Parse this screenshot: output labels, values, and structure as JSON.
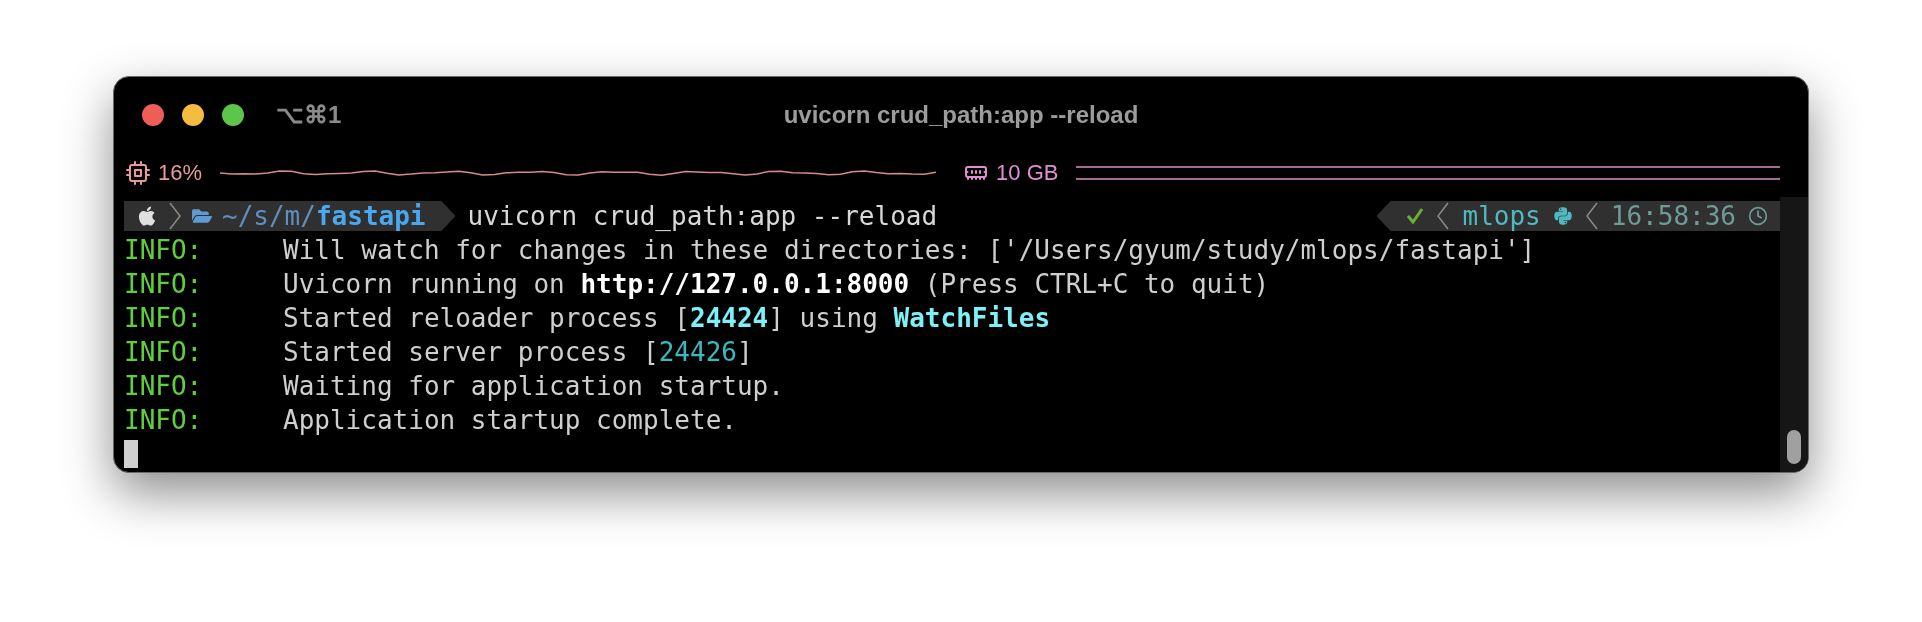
{
  "window": {
    "title": "uvicorn crud_path:app --reload",
    "shortcut": "⌥⌘1"
  },
  "status_bar": {
    "cpu": "16%",
    "memory": "10 GB"
  },
  "prompt": {
    "path_prefix": "~/s/m/",
    "path_current": "fastapi",
    "command": "uvicorn crud_path:app --reload",
    "status_ok": true,
    "env": "mlops",
    "time": "16:58:36"
  },
  "log_lines": [
    {
      "level": "INFO:",
      "parts": [
        {
          "kind": "plain",
          "text": "Will watch for changes in these directories: ['/Users/gyum/study/mlops/fastapi']"
        }
      ]
    },
    {
      "level": "INFO:",
      "parts": [
        {
          "kind": "plain",
          "text": "Uvicorn running on "
        },
        {
          "kind": "bold",
          "text": "http://127.0.0.1:8000"
        },
        {
          "kind": "plain",
          "text": " (Press CTRL+C to quit)"
        }
      ]
    },
    {
      "level": "INFO:",
      "parts": [
        {
          "kind": "plain",
          "text": "Started reloader process ["
        },
        {
          "kind": "cyan-bold",
          "text": "24424"
        },
        {
          "kind": "plain",
          "text": "] using "
        },
        {
          "kind": "cyan-bold",
          "text": "WatchFiles"
        }
      ]
    },
    {
      "level": "INFO:",
      "parts": [
        {
          "kind": "plain",
          "text": "Started server process ["
        },
        {
          "kind": "cyan",
          "text": "24426"
        },
        {
          "kind": "plain",
          "text": "]"
        }
      ]
    },
    {
      "level": "INFO:",
      "parts": [
        {
          "kind": "plain",
          "text": "Waiting for application startup."
        }
      ]
    },
    {
      "level": "INFO:",
      "parts": [
        {
          "kind": "plain",
          "text": "Application startup complete."
        }
      ]
    }
  ]
}
